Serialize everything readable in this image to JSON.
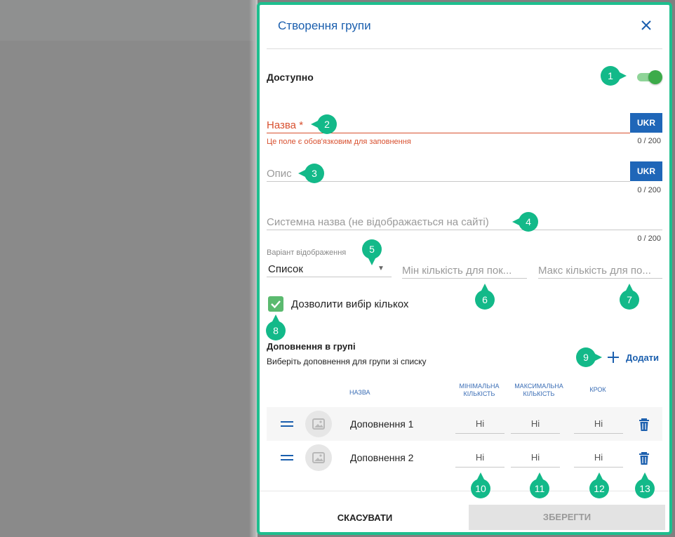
{
  "dialog": {
    "title": "Створення групи",
    "close_icon": "close-icon"
  },
  "available": {
    "label": "Доступно",
    "enabled": true
  },
  "fields": {
    "name": {
      "label": "Назва *",
      "error": "Це поле є обов'язковим для заповнення",
      "counter": "0 / 200",
      "lang": "UKR"
    },
    "description": {
      "placeholder": "Опис",
      "counter": "0 / 200",
      "lang": "UKR"
    },
    "system_name": {
      "placeholder": "Системна назва (не відображається на сайті)",
      "counter": "0 / 200"
    },
    "display_variant": {
      "caption": "Варіант відображення",
      "value": "Список"
    },
    "min_qty": {
      "placeholder": "Мін кількість для пок..."
    },
    "max_qty": {
      "placeholder": "Макс кількість для по..."
    },
    "allow_multiple": {
      "label": "Дозволити вибір кількох",
      "checked": true
    }
  },
  "addons": {
    "title": "Доповнення в групі",
    "subtitle": "Виберіть доповнення для групи зі списку",
    "add_label": "Додати",
    "columns": {
      "name": "НАЗВА",
      "min": [
        "МІНІМАЛЬНА",
        "КІЛЬКІСТЬ"
      ],
      "max": [
        "МАКСИМАЛЬНА",
        "КІЛЬКІСТЬ"
      ],
      "step": "КРОК"
    },
    "rows": [
      {
        "name": "Доповнення 1",
        "min": "Ні",
        "max": "Ні",
        "step": "Ні"
      },
      {
        "name": "Доповнення 2",
        "min": "Ні",
        "max": "Ні",
        "step": "Ні"
      }
    ]
  },
  "footer": {
    "cancel_label": "СКАСУВАТИ",
    "save_label": "ЗБЕРЕГТИ"
  },
  "markers": [
    "1",
    "2",
    "3",
    "4",
    "5",
    "6",
    "7",
    "8",
    "9",
    "10",
    "11",
    "12",
    "13"
  ],
  "colors": {
    "accent": "#1b5fae",
    "error": "#d8502f",
    "marker": "#13b989",
    "toggle": "#3cab4a"
  }
}
